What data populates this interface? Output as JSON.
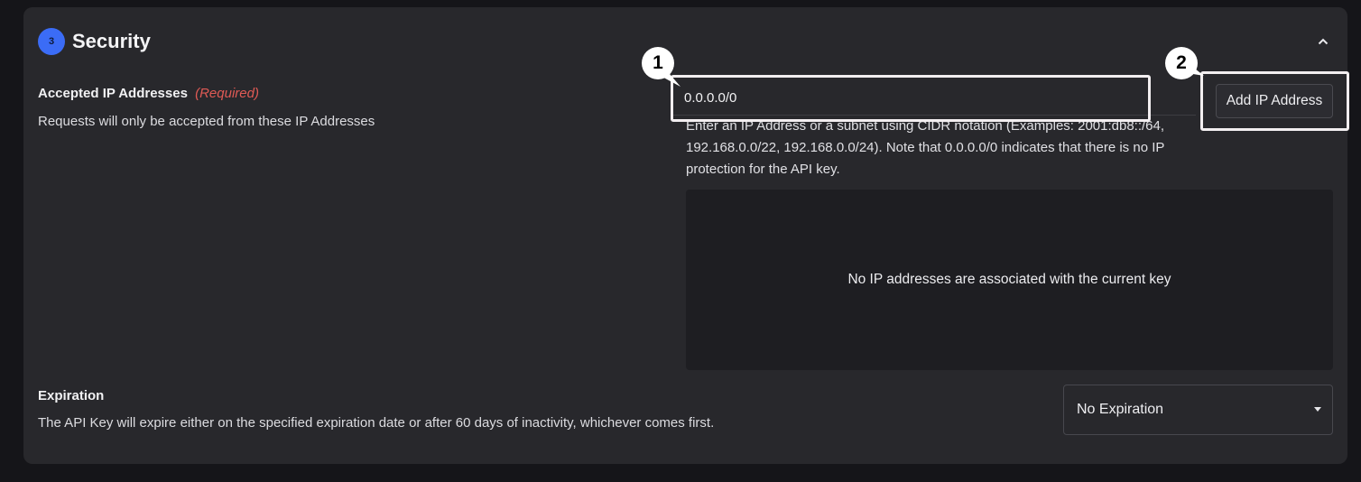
{
  "section": {
    "step_number": "3",
    "title": "Security"
  },
  "ip_addresses": {
    "label": "Accepted IP Addresses",
    "required_tag": "(Required)",
    "description": "Requests will only be accepted from these IP Addresses",
    "input_value": "0.0.0.0/0",
    "hint_text": "Enter an IP Address or a subnet using CIDR notation (Examples: 2001:db8::/64, 192.168.0.0/22, 192.168.0.0/24). Note that 0.0.0.0/0 indicates that there is no IP protection for the API key.",
    "add_button_label": "Add IP Address",
    "empty_message": "No IP addresses are associated with the current key"
  },
  "expiration": {
    "label": "Expiration",
    "description": "The API Key will expire either on the specified expiration date or after 60 days of inactivity, whichever comes first.",
    "selected_option": "No Expiration"
  },
  "annotations": {
    "callout_1": "1",
    "callout_2": "2"
  },
  "colors": {
    "accent": "#3b6cf6",
    "required": "#e05a55",
    "panel": "#28282c",
    "background": "#151519"
  },
  "icons": {
    "collapse": "chevron-up-icon",
    "select_caret": "caret-down-icon"
  }
}
